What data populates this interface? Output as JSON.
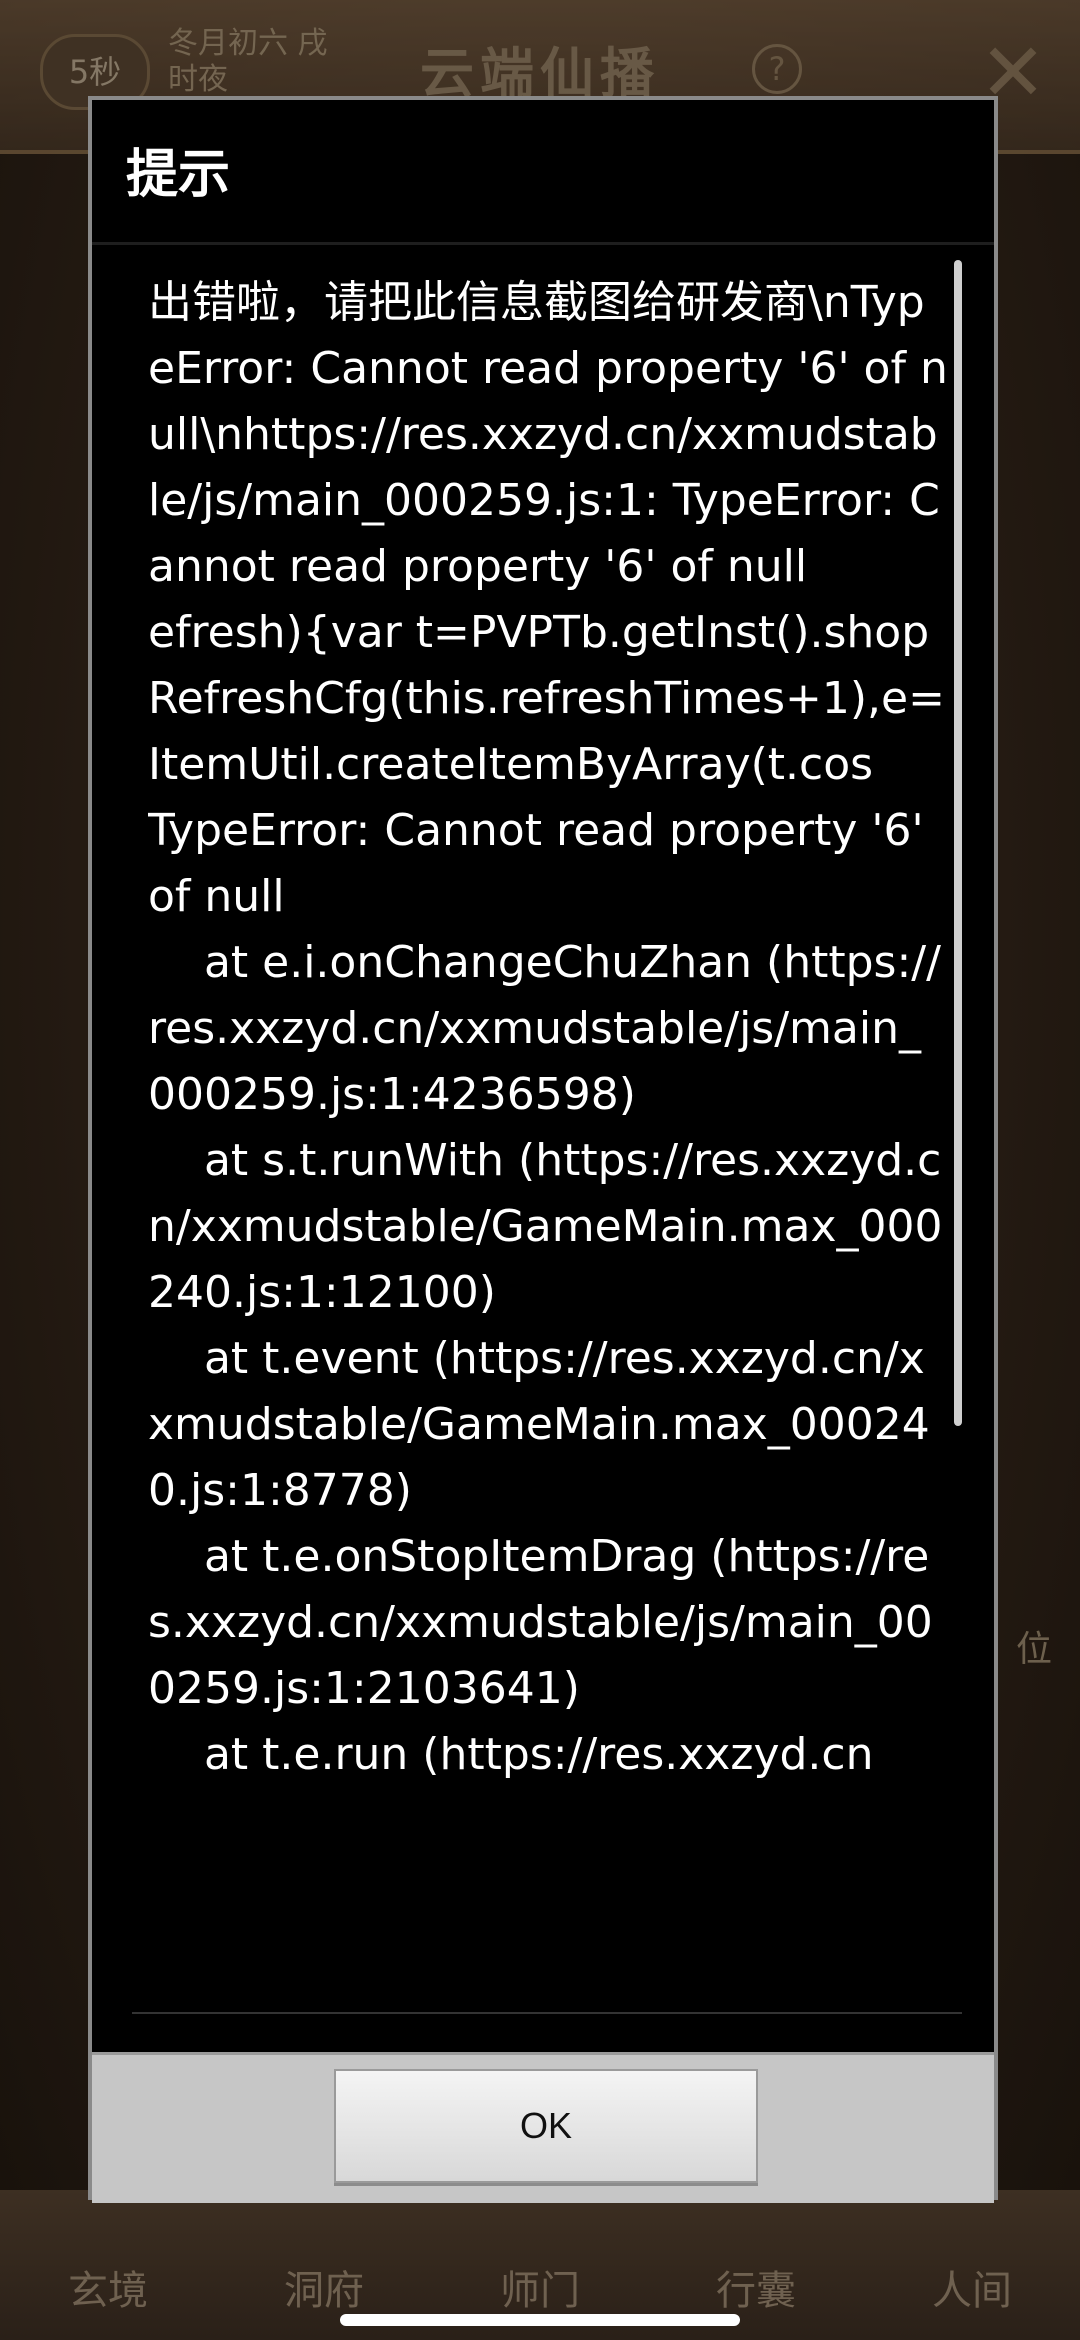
{
  "background": {
    "timer": "5秒",
    "lunar_date": "冬月初六 戌时夜",
    "game_title": "云端仙播",
    "help_icon": "?",
    "side_text": "位",
    "bottom_nav": [
      "玄境",
      "洞府",
      "师门",
      "行囊",
      "人间"
    ]
  },
  "dialog": {
    "title": "提示",
    "message": "出错啦，请把此信息截图给研发商\\nTypeError: Cannot read property '6' of null\\nhttps://res.xxzyd.cn/xxmudstable/js/main_000259.js:1: TypeError: Cannot read property '6' of null\nefresh){var t=PVPTb.getInst().shopRefreshCfg(this.refreshTimes+1),e=ItemUtil.createItemByArray(t.cos\nTypeError: Cannot read property '6' of null\n    at e.i.onChangeChuZhan (https://res.xxzyd.cn/xxmudstable/js/main_000259.js:1:4236598)\n    at s.t.runWith (https://res.xxzyd.cn/xxmudstable/GameMain.max_000240.js:1:12100)\n    at t.event (https://res.xxzyd.cn/xxmudstable/GameMain.max_000240.js:1:8778)\n    at t.e.onStopItemDrag (https://res.xxzyd.cn/xxmudstable/js/main_000259.js:1:2103641)\n    at t.e.run (https://res.xxzyd.cn",
    "ok_label": "OK"
  },
  "colors": {
    "dialog_background": "#000000",
    "dialog_border": "#8a8a8a",
    "button_panel": "#c6c6c6",
    "text": "#ffffff"
  }
}
